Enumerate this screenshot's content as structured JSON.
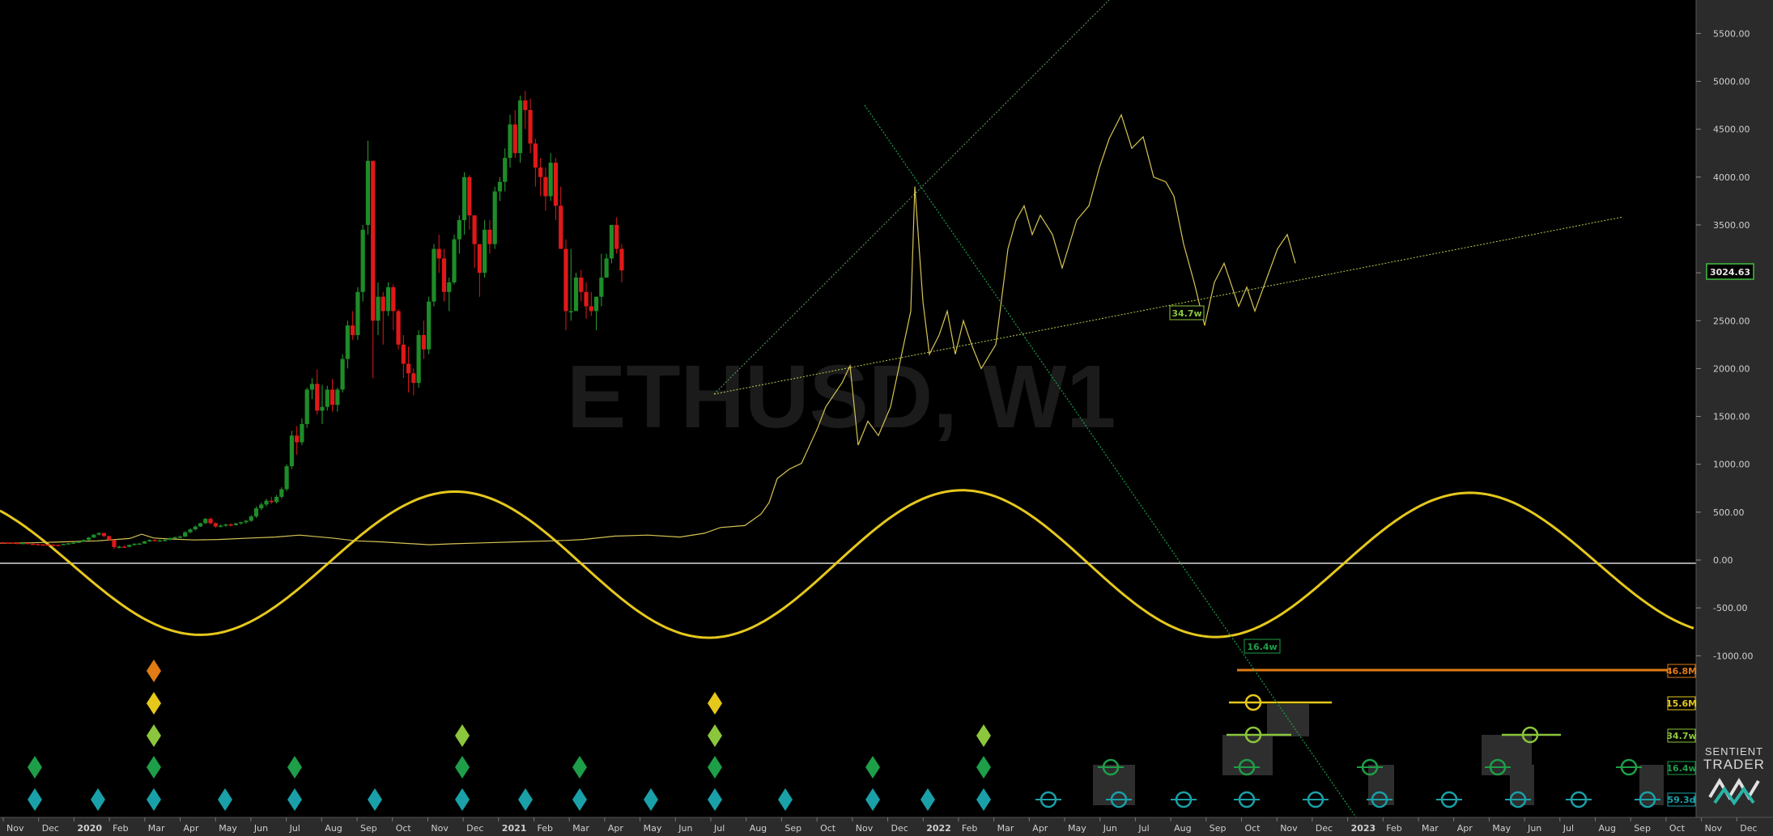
{
  "chart_data": {
    "type": "candlestick",
    "symbol_watermark": "ETHUSD, W1",
    "current_price": "3024.63",
    "price_axis": {
      "ticks": [
        "5500.00",
        "5000.00",
        "4500.00",
        "4000.00",
        "3500.00",
        "3000.00",
        "2500.00",
        "2000.00",
        "1500.00",
        "1000.00",
        "500.00",
        "0.00",
        "-500.00",
        "-1000.00"
      ],
      "ylim": [
        -1150,
        5800
      ]
    },
    "time_axis": {
      "labels": [
        "Nov",
        "Dec",
        "2020",
        "Feb",
        "Mar",
        "Apr",
        "May",
        "Jun",
        "Jul",
        "Aug",
        "Sep",
        "Oct",
        "Nov",
        "Dec",
        "2021",
        "Feb",
        "Mar",
        "Apr",
        "May",
        "Jun",
        "Jul",
        "Aug",
        "Sep",
        "Oct",
        "Nov",
        "Dec",
        "2022",
        "Feb",
        "Mar",
        "Apr",
        "May",
        "Jun",
        "Jul",
        "Aug",
        "Sep",
        "Oct",
        "Nov",
        "Dec",
        "2023",
        "Feb",
        "Mar",
        "Apr",
        "May",
        "Jun",
        "Jul",
        "Aug",
        "Sep",
        "Oct",
        "Nov",
        "Dec"
      ]
    },
    "candles": [
      [
        185,
        190,
        178,
        183
      ],
      [
        183,
        187,
        180,
        182
      ],
      [
        182,
        185,
        177,
        179
      ],
      [
        179,
        182,
        173,
        175
      ],
      [
        175,
        180,
        172,
        178
      ],
      [
        178,
        181,
        165,
        170
      ],
      [
        170,
        174,
        162,
        166
      ],
      [
        166,
        170,
        160,
        163
      ],
      [
        163,
        168,
        158,
        162
      ],
      [
        162,
        166,
        158,
        160
      ],
      [
        160,
        165,
        155,
        158
      ],
      [
        158,
        163,
        152,
        157
      ],
      [
        157,
        170,
        154,
        168
      ],
      [
        168,
        178,
        165,
        175
      ],
      [
        175,
        185,
        170,
        182
      ],
      [
        182,
        195,
        178,
        192
      ],
      [
        192,
        215,
        188,
        210
      ],
      [
        210,
        240,
        205,
        235
      ],
      [
        235,
        270,
        230,
        265
      ],
      [
        265,
        290,
        255,
        282
      ],
      [
        282,
        285,
        240,
        250
      ],
      [
        250,
        255,
        200,
        210
      ],
      [
        210,
        212,
        115,
        135
      ],
      [
        135,
        150,
        120,
        140
      ],
      [
        140,
        150,
        130,
        138
      ],
      [
        138,
        162,
        132,
        158
      ],
      [
        158,
        175,
        150,
        170
      ],
      [
        170,
        178,
        160,
        172
      ],
      [
        172,
        200,
        168,
        195
      ],
      [
        195,
        215,
        188,
        210
      ],
      [
        210,
        215,
        195,
        200
      ],
      [
        200,
        215,
        195,
        205
      ],
      [
        205,
        220,
        198,
        210
      ],
      [
        210,
        235,
        205,
        230
      ],
      [
        230,
        245,
        220,
        238
      ],
      [
        238,
        255,
        228,
        245
      ],
      [
        245,
        300,
        240,
        290
      ],
      [
        290,
        330,
        280,
        320
      ],
      [
        320,
        360,
        310,
        350
      ],
      [
        350,
        390,
        345,
        385
      ],
      [
        385,
        440,
        375,
        430
      ],
      [
        430,
        445,
        370,
        385
      ],
      [
        385,
        395,
        335,
        350
      ],
      [
        350,
        370,
        340,
        360
      ],
      [
        360,
        380,
        345,
        372
      ],
      [
        372,
        385,
        350,
        365
      ],
      [
        365,
        390,
        360,
        382
      ],
      [
        382,
        400,
        370,
        395
      ],
      [
        395,
        420,
        380,
        410
      ],
      [
        410,
        470,
        400,
        455
      ],
      [
        455,
        560,
        440,
        540
      ],
      [
        540,
        600,
        520,
        580
      ],
      [
        580,
        640,
        560,
        620
      ],
      [
        620,
        660,
        585,
        605
      ],
      [
        605,
        680,
        590,
        660
      ],
      [
        660,
        760,
        640,
        740
      ],
      [
        740,
        1000,
        720,
        980
      ],
      [
        980,
        1350,
        950,
        1300
      ],
      [
        1300,
        1400,
        1100,
        1230
      ],
      [
        1230,
        1480,
        1200,
        1420
      ],
      [
        1420,
        1800,
        1380,
        1780
      ],
      [
        1780,
        1900,
        1680,
        1840
      ],
      [
        1840,
        1990,
        1520,
        1560
      ],
      [
        1560,
        1830,
        1420,
        1600
      ],
      [
        1600,
        1820,
        1560,
        1780
      ],
      [
        1780,
        1890,
        1550,
        1620
      ],
      [
        1620,
        1800,
        1550,
        1780
      ],
      [
        1780,
        2150,
        1750,
        2100
      ],
      [
        2100,
        2500,
        2000,
        2450
      ],
      [
        2450,
        2600,
        2300,
        2350
      ],
      [
        2350,
        2850,
        2300,
        2800
      ],
      [
        2800,
        3500,
        2700,
        3450
      ],
      [
        3500,
        4380,
        3400,
        4170
      ],
      [
        4170,
        4100,
        1900,
        2500
      ],
      [
        2500,
        2900,
        2350,
        2750
      ],
      [
        2750,
        2800,
        2250,
        2600
      ],
      [
        2600,
        2900,
        2550,
        2850
      ],
      [
        2850,
        2880,
        2400,
        2600
      ],
      [
        2600,
        2620,
        2200,
        2250
      ],
      [
        2250,
        2350,
        1900,
        2050
      ],
      [
        2050,
        2230,
        1750,
        1950
      ],
      [
        1950,
        2000,
        1720,
        1850
      ],
      [
        1850,
        2400,
        1800,
        2350
      ],
      [
        2350,
        2500,
        2100,
        2200
      ],
      [
        2200,
        2750,
        2150,
        2700
      ],
      [
        2700,
        3300,
        2650,
        3250
      ],
      [
        3250,
        3400,
        3000,
        3150
      ],
      [
        3150,
        3250,
        2700,
        2800
      ],
      [
        2800,
        2950,
        2600,
        2900
      ],
      [
        2900,
        3400,
        2880,
        3350
      ],
      [
        3350,
        3600,
        3200,
        3550
      ],
      [
        3550,
        4050,
        3400,
        4000
      ],
      [
        4000,
        4020,
        3450,
        3600
      ],
      [
        3600,
        3600,
        3050,
        3300
      ],
      [
        3300,
        3200,
        2750,
        3000
      ],
      [
        3000,
        3550,
        2950,
        3450
      ],
      [
        3450,
        3550,
        3200,
        3300
      ],
      [
        3300,
        3900,
        3250,
        3850
      ],
      [
        3850,
        4000,
        3750,
        3950
      ],
      [
        3950,
        4300,
        3850,
        4200
      ],
      [
        4200,
        4650,
        4100,
        4550
      ],
      [
        4550,
        4700,
        4200,
        4250
      ],
      [
        4250,
        4850,
        4150,
        4800
      ],
      [
        4800,
        4900,
        4500,
        4700
      ],
      [
        4700,
        4820,
        4250,
        4350
      ],
      [
        4350,
        4400,
        3900,
        4100
      ],
      [
        4100,
        4200,
        3800,
        4000
      ],
      [
        4000,
        4100,
        3650,
        3800
      ],
      [
        3800,
        4250,
        3750,
        4150
      ],
      [
        4150,
        4200,
        3550,
        3700
      ],
      [
        3700,
        3900,
        3250,
        3250
      ],
      [
        3250,
        3350,
        2400,
        2600
      ],
      [
        2600,
        3250,
        2500,
        2600
      ],
      [
        2600,
        3000,
        2700,
        2950
      ],
      [
        2950,
        3030,
        2700,
        2800
      ],
      [
        2800,
        2900,
        2520,
        2650
      ],
      [
        2650,
        2800,
        2550,
        2600
      ],
      [
        2600,
        2750,
        2400,
        2750
      ],
      [
        2750,
        3200,
        2650,
        2950
      ],
      [
        2950,
        3200,
        2950,
        3150
      ],
      [
        3150,
        3500,
        3100,
        3500
      ],
      [
        3500,
        3580,
        3200,
        3250
      ],
      [
        3250,
        3300,
        2900,
        3025
      ]
    ],
    "overlays": {
      "projection_label": "34.7w",
      "trendline_label": "16.4w"
    },
    "cycle_tags": [
      {
        "label": "46.8M",
        "color": "#e07b16"
      },
      {
        "label": "15.6M",
        "color": "#e6c81c"
      },
      {
        "label": "34.7w",
        "color": "#8bc63c"
      },
      {
        "label": "16.4w",
        "color": "#1e9e48"
      },
      {
        "label": "59.3d",
        "color": "#1aa0a8"
      }
    ]
  },
  "logo": {
    "line1": "SENTIENT",
    "line2": "TRADER"
  }
}
